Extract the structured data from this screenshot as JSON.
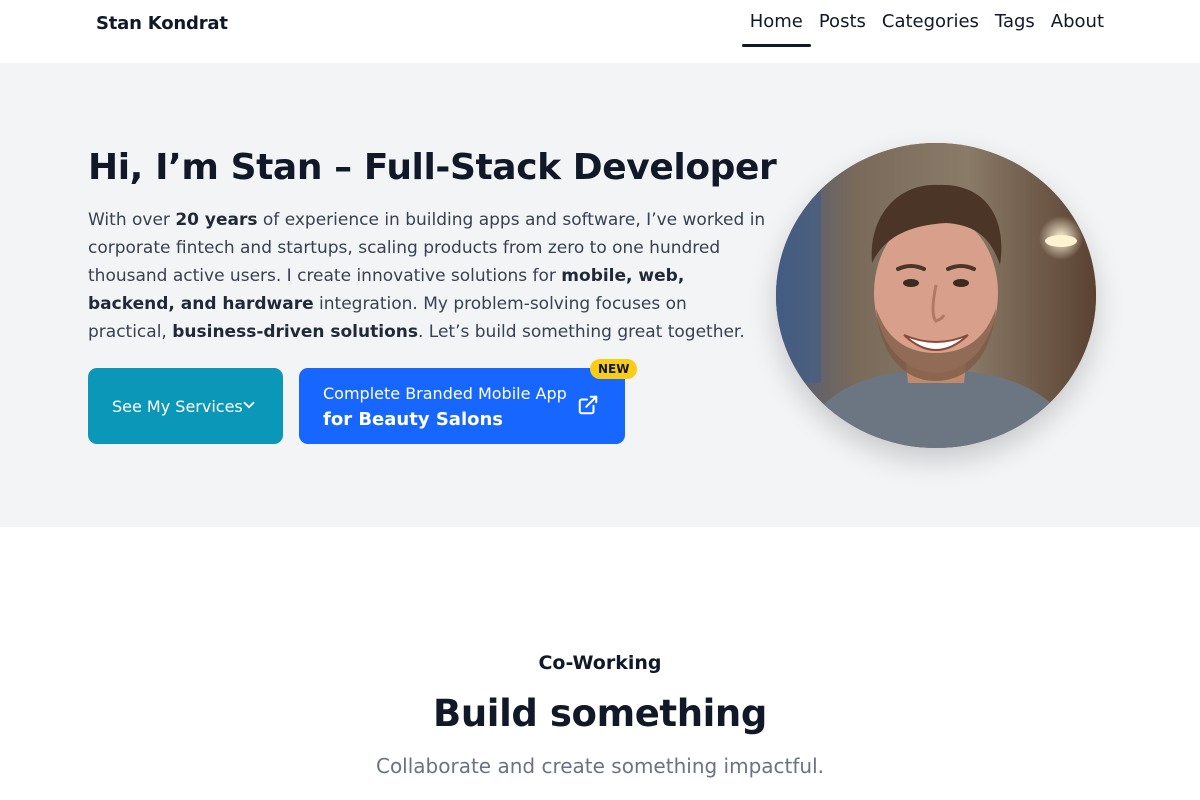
{
  "header": {
    "brand": "Stan Kondrat",
    "nav": [
      {
        "label": "Home",
        "active": true
      },
      {
        "label": "Posts"
      },
      {
        "label": "Categories"
      },
      {
        "label": "Tags"
      },
      {
        "label": "About"
      }
    ]
  },
  "hero": {
    "title": "Hi, I’m Stan – Full-Stack Developer",
    "intro": {
      "p1": "With over ",
      "b1": "20 years",
      "p2": " of experience in building apps and software, I’ve worked in corporate fintech and startups, scaling products from zero to one hundred thousand active users. I create innovative solutions for ",
      "b2": "mobile, web, backend, and hardware",
      "p3": " integration. My problem-solving focuses on practical, ",
      "b3": "business-driven solutions",
      "p4": ". Let’s build something great together."
    },
    "services_button": "See My Services",
    "app_button": {
      "line1": "Complete Branded Mobile App",
      "line2": "for Beauty Salons",
      "badge": "NEW"
    },
    "colors": {
      "services": "#0a97b8",
      "app": "#1766ff",
      "badge": "#facc15"
    }
  },
  "coworking": {
    "label": "Co-Working",
    "title": "Build something",
    "subtitle": "Collaborate and create something impactful."
  }
}
